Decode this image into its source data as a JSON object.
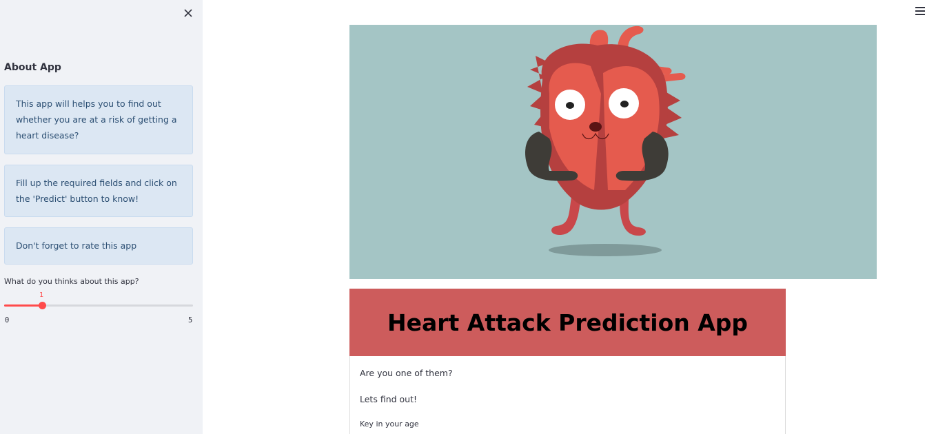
{
  "sidebar": {
    "close_icon": "close-icon",
    "about_title": "About App",
    "info_boxes": [
      "This app will helps you to find out whether you are at a risk of getting a heart disease?",
      "Fill up the required fields and click on the 'Predict' button to know!",
      "Don't forget to rate this app"
    ],
    "slider": {
      "label": "What do you thinks about this app?",
      "value": "1",
      "min": "0",
      "max": "5",
      "fraction": 0.2
    }
  },
  "header": {
    "menu_icon": "hamburger-menu-icon"
  },
  "main": {
    "hero_image": "cartoon-heart-illustration",
    "title": "Heart Attack Prediction App",
    "form": {
      "line1": "Are you one of them?",
      "line2": "Lets find out!",
      "age_label": "Key in your age"
    }
  },
  "colors": {
    "sidebar_bg": "#f0f2f6",
    "info_bg": "#dce7f3",
    "accent": "#ff4b4b",
    "title_banner": "#cd5c5c",
    "hero_bg": "#a4c5c5"
  }
}
